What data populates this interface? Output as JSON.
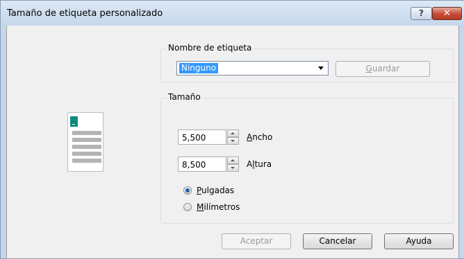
{
  "window": {
    "title": "Tamaño de etiqueta personalizado",
    "help_button": "?",
    "close_button": "✕"
  },
  "label_name_group": {
    "legend": "Nombre de etiqueta",
    "selected_value": "Ninguno",
    "save_button": {
      "prefix": "",
      "accel": "G",
      "suffix": "uardar",
      "enabled": false
    }
  },
  "size_group": {
    "legend": "Tamaño",
    "width": {
      "value": "5,500",
      "label_prefix": "",
      "label_accel": "A",
      "label_suffix": "ncho"
    },
    "height": {
      "value": "8,500",
      "label_prefix": "A",
      "label_accel": "l",
      "label_suffix": "tura"
    },
    "units": [
      {
        "prefix": "",
        "accel": "P",
        "suffix": "ulgadas",
        "checked": true
      },
      {
        "prefix": "",
        "accel": "M",
        "suffix": "ilímetros",
        "checked": false
      }
    ]
  },
  "buttons": {
    "ok": {
      "label": "Aceptar",
      "enabled": false
    },
    "cancel": {
      "label": "Cancelar"
    },
    "help": {
      "label": "Ayuda"
    }
  },
  "colors": {
    "selection": "#3399ff",
    "preview_accent": "#0f8a7d",
    "close_button": "#c74a36"
  }
}
